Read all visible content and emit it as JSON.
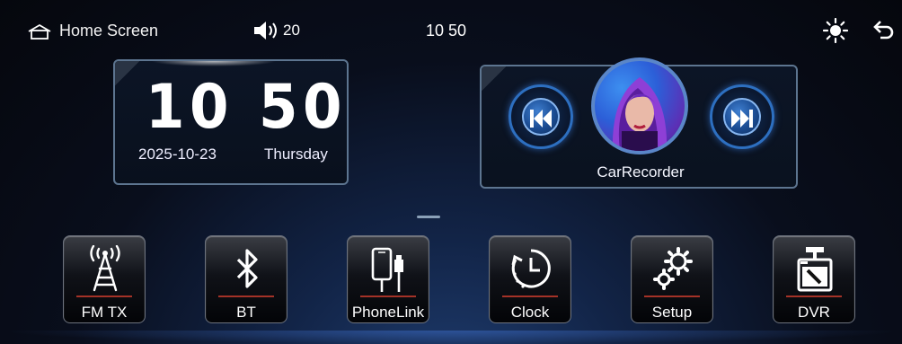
{
  "status_bar": {
    "home_label": "Home Screen",
    "volume": "20",
    "time": "10 50",
    "icons": [
      "home-icon",
      "volume-icon",
      "brightness-icon",
      "back-icon"
    ]
  },
  "clock_widget": {
    "hour": "10",
    "minute": "50",
    "date": "2025-10-23",
    "weekday": "Thursday"
  },
  "media_widget": {
    "track_name": "CarRecorder",
    "icons": [
      "previous-track-icon",
      "next-track-icon",
      "album-art"
    ]
  },
  "pager": {
    "current_page": 1
  },
  "apps": [
    {
      "label": "FM TX",
      "icon": "fm-tower-icon"
    },
    {
      "label": "BT",
      "icon": "bluetooth-icon"
    },
    {
      "label": "PhoneLink",
      "icon": "phone-link-icon"
    },
    {
      "label": "Clock",
      "icon": "clock-icon"
    },
    {
      "label": "Setup",
      "icon": "gears-icon"
    },
    {
      "label": "DVR",
      "icon": "dashcam-icon"
    }
  ],
  "colors": {
    "accent_blue": "#2d6fc0",
    "tile_divider": "#c0392b",
    "card_border": "#5d7590"
  }
}
